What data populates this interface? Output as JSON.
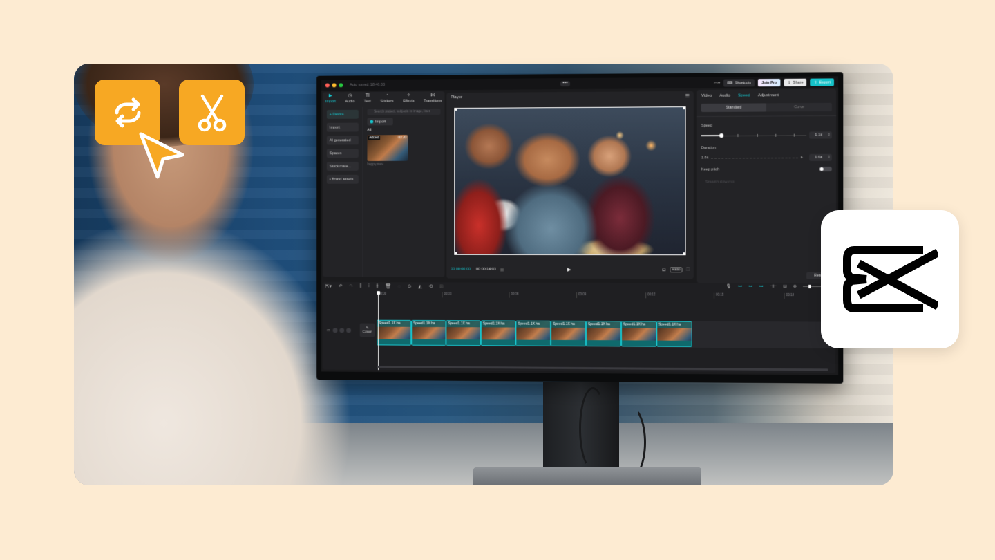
{
  "colors": {
    "page_bg": "#fdebd2",
    "accent_orange": "#f7a823",
    "accent_cyan": "#17c3cb"
  },
  "titlebar": {
    "autosave": "Auto saved: 18:46:33",
    "shortcuts": "Shortcuts",
    "join_pro": "Join Pro",
    "share": "Share",
    "export": "Export"
  },
  "left_panel": {
    "tabs": [
      {
        "label": "Import",
        "icon": "import-icon"
      },
      {
        "label": "Audio",
        "icon": "audio-icon"
      },
      {
        "label": "Text",
        "icon": "text-icon"
      },
      {
        "label": "Stickers",
        "icon": "stickers-icon"
      },
      {
        "label": "Effects",
        "icon": "effects-icon"
      },
      {
        "label": "Transitions",
        "icon": "transitions-icon"
      }
    ],
    "nav": [
      "+ Device",
      "Import",
      "AI generated",
      "Spaces",
      "Stock mate...",
      "• Brand assets"
    ],
    "search_placeholder": "Search project, subjects in image, lines",
    "import_button": "Import",
    "all_label": "All",
    "thumb_badge": "Added",
    "thumb_duration": "00:20",
    "thumb_name": "happy.mov"
  },
  "player": {
    "title": "Player",
    "current_time": "00:00:00:00",
    "total_time": "00:00:14:03",
    "ratio": "Ratio"
  },
  "right_panel": {
    "tabs": [
      "Video",
      "Audio",
      "Speed",
      "Adjustment"
    ],
    "segments": [
      "Standard",
      "Curve"
    ],
    "speed_label": "Speed",
    "speed_value": "1.1x",
    "duration_label": "Duration",
    "duration_start": "1.8s",
    "duration_value": "1.6s",
    "keep_pitch": "Keep pitch",
    "smooth": "Smooth slow-mo",
    "reset": "Reset"
  },
  "timeline": {
    "ruler": [
      "00:00",
      "00:03",
      "00:06",
      "00:09",
      "00:12",
      "00:15",
      "00:18"
    ],
    "cover": "Cover",
    "clip_label": "Speed1.1X  ha",
    "clip_count": 9
  }
}
